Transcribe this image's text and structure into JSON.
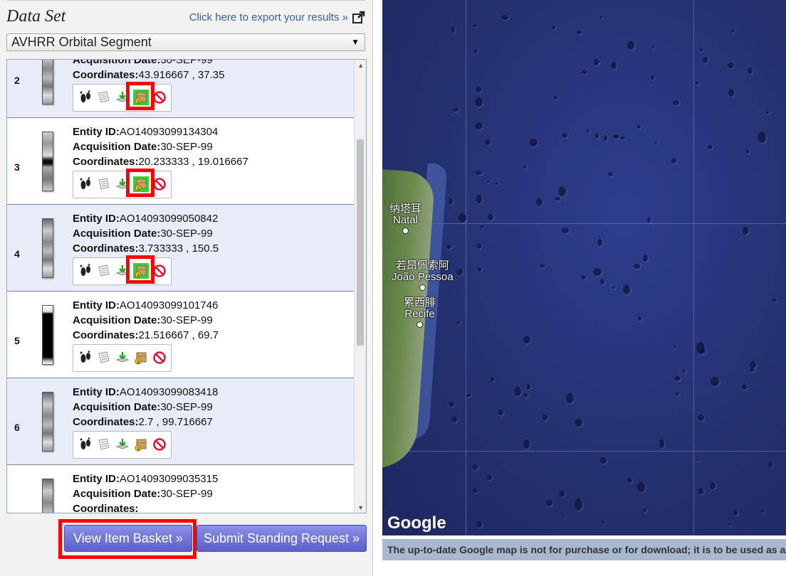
{
  "panel": {
    "title": "Data Set",
    "export_link": "Click here to export your results »",
    "dataset_selected": "AVHRR Orbital Segment"
  },
  "labels": {
    "entity_id": "Entity ID:",
    "acquisition_date": "Acquisition Date:",
    "coordinates": "Coordinates:"
  },
  "results": [
    {
      "num": "2",
      "entity_id": "",
      "acquisition_date": "30-SEP-99",
      "coordinates": "43.916667 , 37.35",
      "basket_highlighted": true
    },
    {
      "num": "3",
      "entity_id": "AO14093099134304",
      "acquisition_date": "30-SEP-99",
      "coordinates": "20.233333 , 19.016667",
      "basket_highlighted": true
    },
    {
      "num": "4",
      "entity_id": "AO14093099050842",
      "acquisition_date": "30-SEP-99",
      "coordinates": "3.733333 , 150.5",
      "basket_highlighted": true
    },
    {
      "num": "5",
      "entity_id": "AO14093099101746",
      "acquisition_date": "30-SEP-99",
      "coordinates": "21.516667 , 69.7",
      "basket_highlighted": false
    },
    {
      "num": "6",
      "entity_id": "AO14093099083418",
      "acquisition_date": "30-SEP-99",
      "coordinates": "2.7 , 99.716667",
      "basket_highlighted": false
    },
    {
      "num": "",
      "entity_id": "AO14093099035315",
      "acquisition_date": "30-SEP-99",
      "coordinates": "",
      "basket_highlighted": false
    }
  ],
  "tool_icons": [
    "footprint-icon",
    "metadata-icon",
    "download-icon",
    "add-to-basket-icon",
    "exclude-icon"
  ],
  "buttons": {
    "view_basket": "View Item Basket »",
    "standing_request": "Submit Standing Request »"
  },
  "map": {
    "cities": [
      {
        "zh": "纳塔耳",
        "en": "Natal"
      },
      {
        "zh": "若昂佩索阿",
        "en": "João Pessoa"
      },
      {
        "zh": "累西腓",
        "en": "Recife"
      }
    ],
    "brand": "Google",
    "note": "The up-to-date Google map is not for purchase or for download; it is to be used as a"
  },
  "colors": {
    "highlight": "#ff0000",
    "basket_active": "#2fd52f",
    "button": "#6a6fd8",
    "ocean": "#2a377f"
  }
}
